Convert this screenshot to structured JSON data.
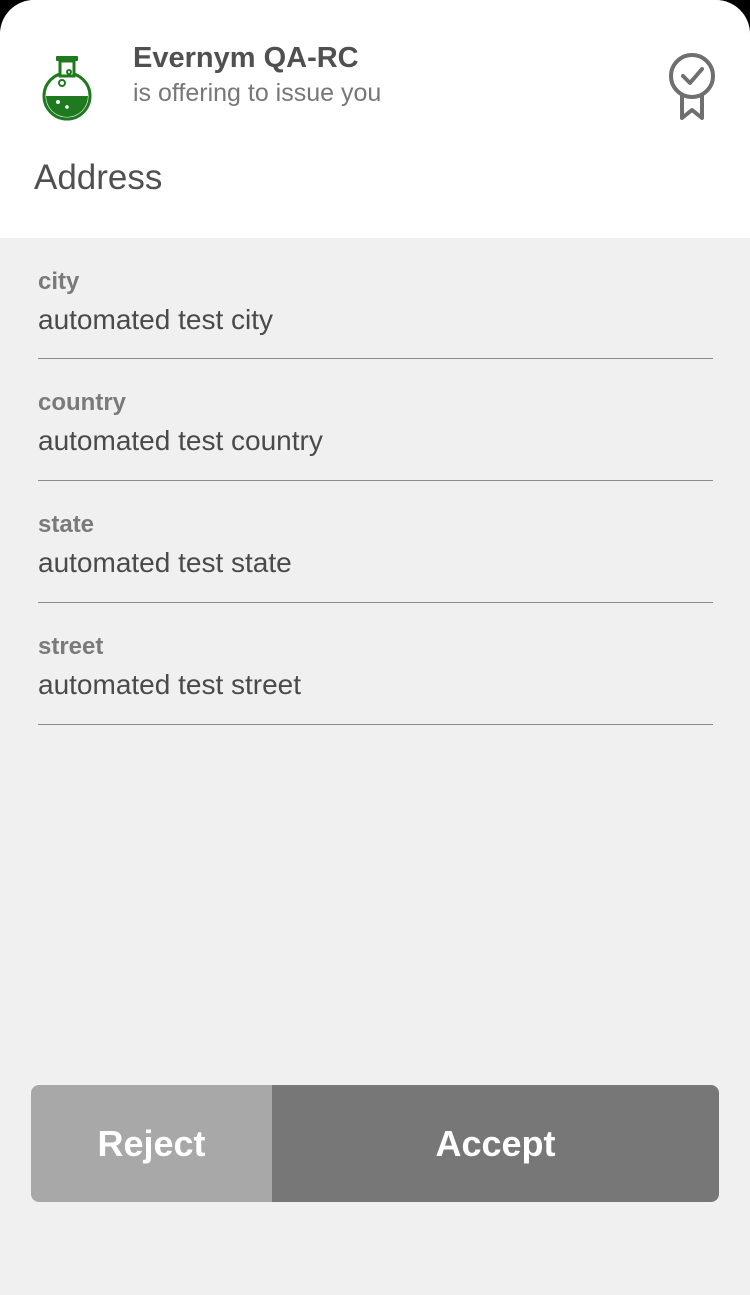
{
  "header": {
    "issuer_name": "Evernym QA-RC",
    "subtitle": "is offering to issue you",
    "logo_icon": "flask-icon",
    "badge_icon": "award-ribbon-icon",
    "brand_color": "#1f7a1f"
  },
  "credential": {
    "title": "Address",
    "attributes": [
      {
        "label": "city",
        "value": "automated test city"
      },
      {
        "label": "country",
        "value": "automated test country"
      },
      {
        "label": "state",
        "value": "automated test state"
      },
      {
        "label": "street",
        "value": "automated test street"
      }
    ]
  },
  "actions": {
    "reject_label": "Reject",
    "accept_label": "Accept"
  }
}
